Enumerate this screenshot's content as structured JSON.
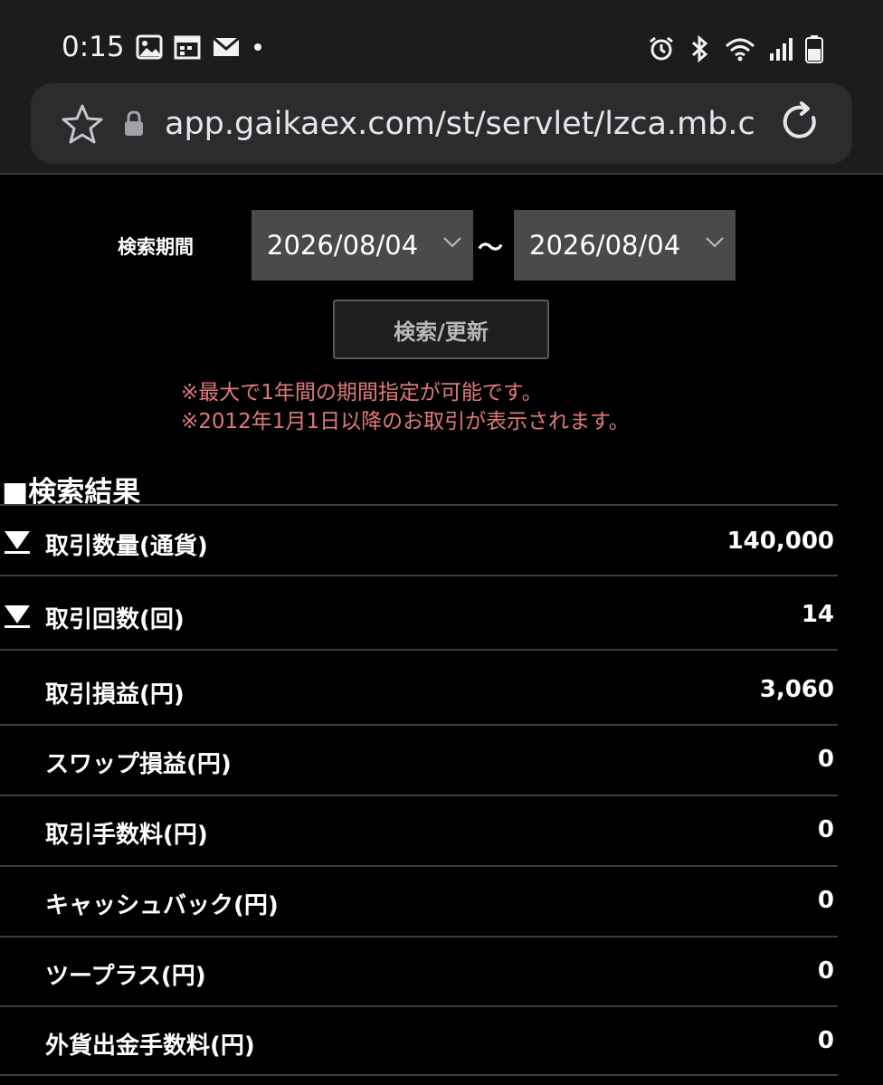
{
  "status_bar": {
    "time": "0:15"
  },
  "browser": {
    "url": "app.gaikaex.com/st/servlet/lzca.mb.c"
  },
  "search": {
    "period_label": "検索期間",
    "from_date": "2026/08/04",
    "to_date": "2026/08/04",
    "separator": "〜",
    "button_label": "検索/更新",
    "notes": [
      "※最大で1年間の期間指定が可能です。",
      "※2012年1月1日以降のお取引が表示されます。"
    ]
  },
  "results": {
    "heading": "■検索結果",
    "rows": [
      {
        "label": "取引数量(通貨)",
        "value": "140,000"
      },
      {
        "label": "取引回数(回)",
        "value": "14"
      },
      {
        "label": "取引損益(円)",
        "value": "3,060"
      },
      {
        "label": "スワップ損益(円)",
        "value": "0"
      },
      {
        "label": "取引手数料(円)",
        "value": "0"
      },
      {
        "label": "キャッシュバック(円)",
        "value": "0"
      },
      {
        "label": "ツープラス(円)",
        "value": "0"
      },
      {
        "label": "外貨出金手数料(円)",
        "value": "0"
      }
    ]
  },
  "colors": {
    "note_text": "#e07a7a",
    "select_bg": "#4a4a4a",
    "chrome_bg": "#1c1c1e"
  }
}
